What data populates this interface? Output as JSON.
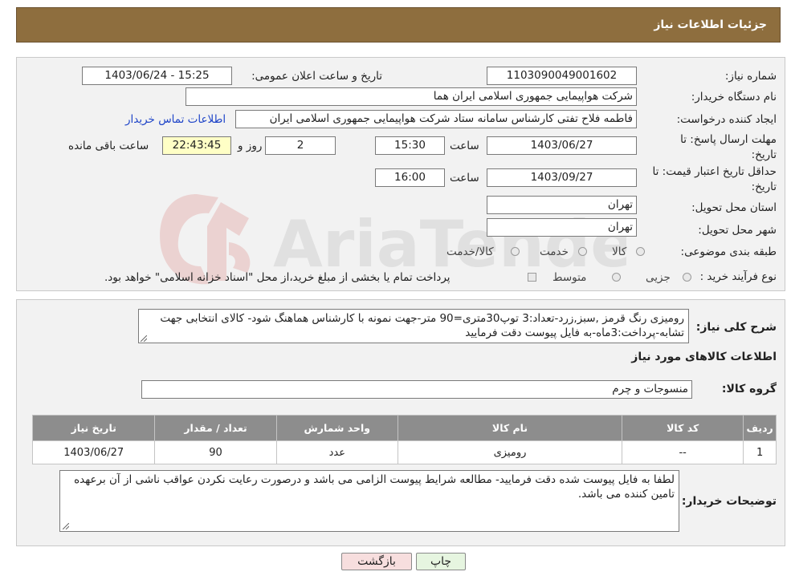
{
  "header": {
    "title": "جزئیات اطلاعات نیاز"
  },
  "form": {
    "need_number_label": "شماره نیاز:",
    "need_number": "1103090049001602",
    "announce_label": "تاریخ و ساعت اعلان عمومی:",
    "announce_value": "1403/06/24 - 15:25",
    "buyer_org_label": "نام دستگاه خریدار:",
    "buyer_org": "شرکت هواپیمایی جمهوری اسلامی ایران هما",
    "creator_label": "ایجاد کننده درخواست:",
    "creator": "فاطمه فلاح تفتی کارشناس سامانه ستاد شرکت هواپیمایی جمهوری اسلامی ایران",
    "contact_link": "اطلاعات تماس خریدار",
    "deadline_label_1": "مهلت ارسال پاسخ: تا",
    "deadline_label_2": "تاریخ:",
    "deadline_date": "1403/06/27",
    "time_label": "ساعت",
    "deadline_time": "15:30",
    "days_value": "2",
    "days_label": "روز و",
    "remaining_time": "22:43:45",
    "remaining_label": "ساعت باقی مانده",
    "validity_label_1": "حداقل تاریخ اعتبار قیمت: تا",
    "validity_label_2": "تاریخ:",
    "validity_date": "1403/09/27",
    "validity_time": "16:00",
    "province_label": "استان محل تحویل:",
    "province": "تهران",
    "city_label": "شهر محل تحویل:",
    "city": "تهران",
    "category_label": "طبقه بندی موضوعی:",
    "category_options": [
      "کالا",
      "خدمت",
      "کالا/خدمت"
    ],
    "process_label": "نوع فرآیند خرید :",
    "process_options": [
      "جزیی",
      "متوسط"
    ],
    "process_note": "پرداخت تمام یا بخشی از مبلغ خرید،از محل \"اسناد خزانه اسلامی\" خواهد بود."
  },
  "details": {
    "description_label": "شرح کلی نیاز:",
    "description": "رومیزی رنگ قرمز ,سبز,زرد-تعداد:3 توپ30متری=90 متر-جهت نمونه با کارشناس هماهنگ شود- کالای انتخابی جهت تشابه-پرداخت:3ماه-به فایل پیوست دقت فرمایید",
    "goods_info_title": "اطلاعات کالاهای مورد نیاز",
    "goods_group_label": "گروه کالا:",
    "goods_group": "منسوجات و چرم",
    "table": {
      "headers": [
        "ردیف",
        "کد کالا",
        "نام کالا",
        "واحد شمارش",
        "تعداد / مقدار",
        "تاریخ نیاز"
      ],
      "rows": [
        [
          "1",
          "--",
          "رومیزی",
          "عدد",
          "90",
          "1403/06/27"
        ]
      ]
    },
    "buyer_notes_label": "توضیحات خریدار:",
    "buyer_notes": "لطفا به فایل پیوست شده دقت فرمایید- مطالعه شرایط پیوست الزامی می باشد و درصورت رعایت نکردن عواقب ناشی از آن برعهده تامین کننده می باشد."
  },
  "buttons": {
    "print": "چاپ",
    "back": "بازگشت"
  },
  "watermark": {
    "text": "AriaTender.neT"
  },
  "colors": {
    "header_bg": "#8e6e3e",
    "table_header_bg": "#8d8d8d",
    "remaining_bg": "#ffffc6",
    "back_button_bg": "#f7dede",
    "print_button_bg": "#e6f5e0"
  }
}
